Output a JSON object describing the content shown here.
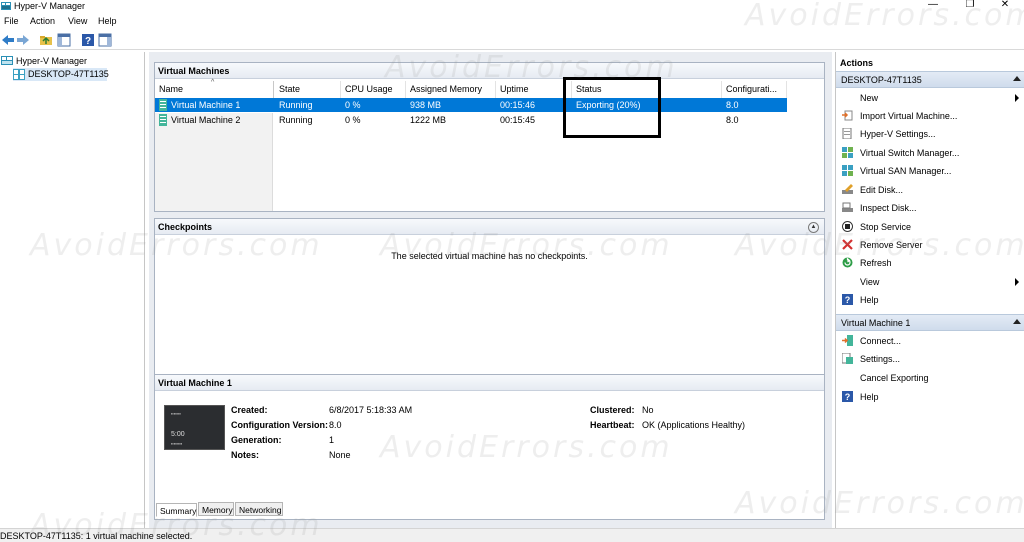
{
  "window": {
    "title": "Hyper-V Manager",
    "min": "—",
    "max": "❐",
    "close": "✕"
  },
  "menu": [
    "File",
    "Action",
    "View",
    "Help"
  ],
  "tree": {
    "root": "Hyper-V Manager",
    "host": "DESKTOP-47T1135"
  },
  "vm_panel": {
    "title": "Virtual Machines",
    "columns": [
      "Name",
      "State",
      "CPU Usage",
      "Assigned Memory",
      "Uptime",
      "Status",
      "Configurati..."
    ],
    "rows": [
      {
        "name": "Virtual Machine 1",
        "state": "Running",
        "cpu": "0 %",
        "memory": "938 MB",
        "uptime": "00:15:46",
        "status": "Exporting (20%)",
        "config": "8.0",
        "selected": true
      },
      {
        "name": "Virtual Machine 2",
        "state": "Running",
        "cpu": "0 %",
        "memory": "1222 MB",
        "uptime": "00:15:45",
        "status": "",
        "config": "8.0",
        "selected": false
      }
    ]
  },
  "checkpoints": {
    "title": "Checkpoints",
    "empty": "The selected virtual machine has no checkpoints."
  },
  "details": {
    "title": "Virtual Machine 1",
    "thumb_time": "5:00",
    "created_label": "Created:",
    "created": "6/8/2017 5:18:33 AM",
    "config_label": "Configuration Version:",
    "config": "8.0",
    "gen_label": "Generation:",
    "gen": "1",
    "notes_label": "Notes:",
    "notes": "None",
    "clustered_label": "Clustered:",
    "clustered": "No",
    "heartbeat_label": "Heartbeat:",
    "heartbeat": "OK (Applications Healthy)",
    "tabs": [
      "Summary",
      "Memory",
      "Networking"
    ]
  },
  "actions": {
    "title": "Actions",
    "host_section": "DESKTOP-47T1135",
    "host_items": [
      "New",
      "Import Virtual Machine...",
      "Hyper-V Settings...",
      "Virtual Switch Manager...",
      "Virtual SAN Manager...",
      "Edit Disk...",
      "Inspect Disk...",
      "Stop Service",
      "Remove Server",
      "Refresh",
      "View",
      "Help"
    ],
    "vm_section": "Virtual Machine 1",
    "vm_items": [
      "Connect...",
      "Settings...",
      "Cancel Exporting",
      "Help"
    ]
  },
  "status": "DESKTOP-47T1135:  1 virtual machine selected.",
  "watermark": "AvoidErrors.com",
  "colors": {
    "selection": "#0078d7",
    "accent_section": "#d7e2f0"
  }
}
